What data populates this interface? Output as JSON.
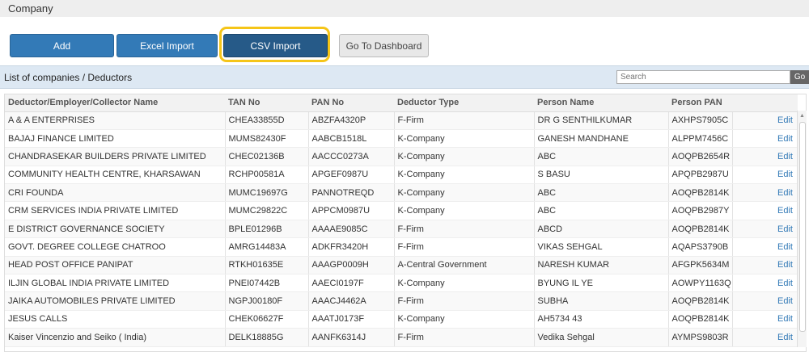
{
  "header": {
    "title": "Company"
  },
  "toolbar": {
    "add": "Add",
    "excel_import": "Excel Import",
    "csv_import": "CSV Import",
    "dashboard": "Go To Dashboard"
  },
  "panel": {
    "title": "List of companies / Deductors",
    "search_placeholder": "Search",
    "go": "Go"
  },
  "table": {
    "columns": [
      "Deductor/Employer/Collector Name",
      "TAN No",
      "PAN No",
      "Deductor Type",
      "Person Name",
      "Person PAN",
      ""
    ],
    "edit_label": "Edit",
    "rows": [
      [
        "A & A ENTERPRISES",
        "CHEA33855D",
        "ABZFA4320P",
        "F-Firm",
        "DR G SENTHILKUMAR",
        "AXHPS7905C"
      ],
      [
        "BAJAJ FINANCE LIMITED",
        "MUMS82430F",
        "AABCB1518L",
        "K-Company",
        "GANESH MANDHANE",
        "ALPPM7456C"
      ],
      [
        "CHANDRASEKAR BUILDERS PRIVATE LIMITED",
        "CHEC02136B",
        "AACCC0273A",
        "K-Company",
        "ABC",
        "AOQPB2654R"
      ],
      [
        "COMMUNITY HEALTH CENTRE, KHARSAWAN",
        "RCHP00581A",
        "APGEF0987U",
        "K-Company",
        "S BASU",
        "APQPB2987U"
      ],
      [
        "CRI FOUNDA",
        "MUMC19697G",
        "PANNOTREQD",
        "K-Company",
        "ABC",
        "AOQPB2814K"
      ],
      [
        "CRM SERVICES INDIA PRIVATE LIMITED",
        "MUMC29822C",
        "APPCM0987U",
        "K-Company",
        "ABC",
        "AOQPB2987Y"
      ],
      [
        "E DISTRICT GOVERNANCE SOCIETY",
        "BPLE01296B",
        "AAAAE9085C",
        "F-Firm",
        "ABCD",
        "AOQPB2814K"
      ],
      [
        "GOVT. DEGREE COLLEGE CHATROO",
        "AMRG14483A",
        "ADKFR3420H",
        "F-Firm",
        "VIKAS SEHGAL",
        "AQAPS3790B"
      ],
      [
        "HEAD POST OFFICE PANIPAT",
        "RTKH01635E",
        "AAAGP0009H",
        "A-Central Government",
        "NARESH KUMAR",
        "AFGPK5634M"
      ],
      [
        "ILJIN GLOBAL INDIA PRIVATE LIMITED",
        "PNEI07442B",
        "AAECI0197F",
        "K-Company",
        "BYUNG IL YE",
        "AOWPY1163Q"
      ],
      [
        "JAIKA AUTOMOBILES PRIVATE LIMITED",
        "NGPJ00180F",
        "AAACJ4462A",
        "F-Firm",
        "SUBHA",
        "AOQPB2814K"
      ],
      [
        "JESUS CALLS",
        "CHEK06627F",
        "AAATJ0173F",
        "K-Company",
        "AH5734 43",
        "AOQPB2814K"
      ],
      [
        "Kaiser Vincenzio and Seiko ( India)",
        "DELK18885G",
        "AANFK6314J",
        "F-Firm",
        "Vedika Sehgal",
        "AYMPS9803R"
      ]
    ]
  }
}
